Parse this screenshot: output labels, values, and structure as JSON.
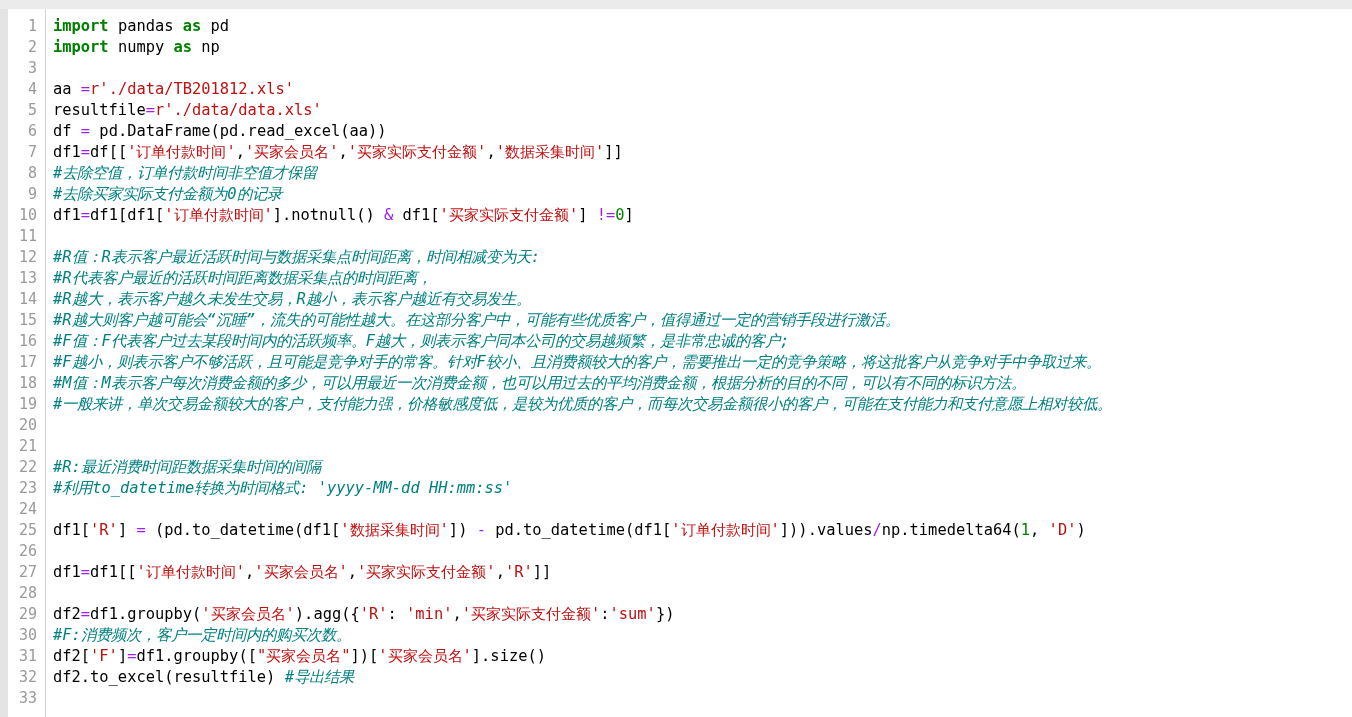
{
  "lines": [
    {
      "number": "1",
      "tokens": [
        {
          "kind": "keyword",
          "text": "import"
        },
        {
          "kind": "plain",
          "text": " pandas "
        },
        {
          "kind": "keyword",
          "text": "as"
        },
        {
          "kind": "plain",
          "text": " pd"
        }
      ]
    },
    {
      "number": "2",
      "tokens": [
        {
          "kind": "keyword",
          "text": "import"
        },
        {
          "kind": "plain",
          "text": " numpy "
        },
        {
          "kind": "keyword",
          "text": "as"
        },
        {
          "kind": "plain",
          "text": " np"
        }
      ]
    },
    {
      "number": "3"
    },
    {
      "number": "4",
      "tokens": [
        {
          "kind": "plain",
          "text": "aa "
        },
        {
          "kind": "operator",
          "text": "="
        },
        {
          "kind": "string",
          "text": "r'./data/TB201812.xls'"
        }
      ]
    },
    {
      "number": "5",
      "tokens": [
        {
          "kind": "plain",
          "text": "resultfile"
        },
        {
          "kind": "operator",
          "text": "="
        },
        {
          "kind": "string",
          "text": "r'./data/data.xls'"
        }
      ]
    },
    {
      "number": "6",
      "tokens": [
        {
          "kind": "plain",
          "text": "df "
        },
        {
          "kind": "operator",
          "text": "="
        },
        {
          "kind": "plain",
          "text": " pd.DataFrame(pd.read_excel(aa))"
        }
      ]
    },
    {
      "number": "7",
      "tokens": [
        {
          "kind": "plain",
          "text": "df1"
        },
        {
          "kind": "operator",
          "text": "="
        },
        {
          "kind": "plain",
          "text": "df[["
        },
        {
          "kind": "string",
          "text": "'订单付款时间'"
        },
        {
          "kind": "plain",
          "text": ","
        },
        {
          "kind": "string",
          "text": "'买家会员名'"
        },
        {
          "kind": "plain",
          "text": ","
        },
        {
          "kind": "string",
          "text": "'买家实际支付金额'"
        },
        {
          "kind": "plain",
          "text": ","
        },
        {
          "kind": "string",
          "text": "'数据采集时间'"
        },
        {
          "kind": "plain",
          "text": "]]"
        }
      ]
    },
    {
      "number": "8",
      "tokens": [
        {
          "kind": "comment",
          "text": "#去除空值，订单付款时间非空值才保留"
        }
      ]
    },
    {
      "number": "9",
      "tokens": [
        {
          "kind": "comment",
          "text": "#去除买家实际支付金额为0的记录"
        }
      ]
    },
    {
      "number": "10",
      "tokens": [
        {
          "kind": "plain",
          "text": "df1"
        },
        {
          "kind": "operator",
          "text": "="
        },
        {
          "kind": "plain",
          "text": "df1[df1["
        },
        {
          "kind": "string",
          "text": "'订单付款时间'"
        },
        {
          "kind": "plain",
          "text": "].notnull() "
        },
        {
          "kind": "operator",
          "text": "&"
        },
        {
          "kind": "plain",
          "text": " df1["
        },
        {
          "kind": "string",
          "text": "'买家实际支付金额'"
        },
        {
          "kind": "plain",
          "text": "] "
        },
        {
          "kind": "operator",
          "text": "!="
        },
        {
          "kind": "number",
          "text": "0"
        },
        {
          "kind": "plain",
          "text": "]"
        }
      ]
    },
    {
      "number": "11"
    },
    {
      "number": "12",
      "tokens": [
        {
          "kind": "comment",
          "text": "#R值：R表示客户最近活跃时间与数据采集点时间距离，时间相减变为天:"
        }
      ]
    },
    {
      "number": "13",
      "tokens": [
        {
          "kind": "comment",
          "text": "#R代表客户最近的活跃时间距离数据采集点的时间距离，"
        }
      ]
    },
    {
      "number": "14",
      "tokens": [
        {
          "kind": "comment",
          "text": "#R越大，表示客户越久未发生交易，R越小，表示客户越近有交易发生。"
        }
      ]
    },
    {
      "number": "15",
      "tokens": [
        {
          "kind": "comment",
          "text": "#R越大则客户越可能会“沉睡”，流失的可能性越大。在这部分客户中，可能有些优质客户，值得通过一定的营销手段进行激活。"
        }
      ]
    },
    {
      "number": "16",
      "tokens": [
        {
          "kind": "comment",
          "text": "#F值：F代表客户过去某段时间内的活跃频率。F越大，则表示客户同本公司的交易越频繁，是非常忠诚的客户;"
        }
      ]
    },
    {
      "number": "17",
      "tokens": [
        {
          "kind": "comment",
          "text": "#F越小，则表示客户不够活跃，且可能是竞争对手的常客。针对F较小、且消费额较大的客户，需要推出一定的竞争策略，将这批客户从竞争对手中争取过来。"
        }
      ]
    },
    {
      "number": "18",
      "tokens": [
        {
          "kind": "comment",
          "text": "#M值：M表示客户每次消费金额的多少，可以用最近一次消费金额，也可以用过去的平均消费金额，根据分析的目的不同，可以有不同的标识方法。"
        }
      ]
    },
    {
      "number": "19",
      "tokens": [
        {
          "kind": "comment",
          "text": "#一般来讲，单次交易金额较大的客户，支付能力强，价格敏感度低，是较为优质的客户，而每次交易金额很小的客户，可能在支付能力和支付意愿上相对较低。"
        }
      ]
    },
    {
      "number": "20"
    },
    {
      "number": "21"
    },
    {
      "number": "22",
      "tokens": [
        {
          "kind": "comment",
          "text": "#R:最近消费时间距数据采集时间的间隔"
        }
      ]
    },
    {
      "number": "23",
      "tokens": [
        {
          "kind": "comment",
          "text": "#利用to_datetime转换为时间格式: 'yyyy-MM-dd HH:mm:ss'"
        }
      ]
    },
    {
      "number": "24"
    },
    {
      "number": "25",
      "tokens": [
        {
          "kind": "plain",
          "text": "df1["
        },
        {
          "kind": "string",
          "text": "'R'"
        },
        {
          "kind": "plain",
          "text": "] "
        },
        {
          "kind": "operator",
          "text": "="
        },
        {
          "kind": "plain",
          "text": " (pd.to_datetime(df1["
        },
        {
          "kind": "string",
          "text": "'数据采集时间'"
        },
        {
          "kind": "plain",
          "text": "]) "
        },
        {
          "kind": "operator",
          "text": "-"
        },
        {
          "kind": "plain",
          "text": " pd.to_datetime(df1["
        },
        {
          "kind": "string",
          "text": "'订单付款时间'"
        },
        {
          "kind": "plain",
          "text": "])).values"
        },
        {
          "kind": "operator",
          "text": "/"
        },
        {
          "kind": "plain",
          "text": "np.timedelta64("
        },
        {
          "kind": "number",
          "text": "1"
        },
        {
          "kind": "plain",
          "text": ", "
        },
        {
          "kind": "string",
          "text": "'D'"
        },
        {
          "kind": "plain",
          "text": ")"
        }
      ]
    },
    {
      "number": "26"
    },
    {
      "number": "27",
      "tokens": [
        {
          "kind": "plain",
          "text": "df1"
        },
        {
          "kind": "operator",
          "text": "="
        },
        {
          "kind": "plain",
          "text": "df1[["
        },
        {
          "kind": "string",
          "text": "'订单付款时间'"
        },
        {
          "kind": "plain",
          "text": ","
        },
        {
          "kind": "string",
          "text": "'买家会员名'"
        },
        {
          "kind": "plain",
          "text": ","
        },
        {
          "kind": "string",
          "text": "'买家实际支付金额'"
        },
        {
          "kind": "plain",
          "text": ","
        },
        {
          "kind": "string",
          "text": "'R'"
        },
        {
          "kind": "plain",
          "text": "]]"
        }
      ]
    },
    {
      "number": "28"
    },
    {
      "number": "29",
      "tokens": [
        {
          "kind": "plain",
          "text": "df2"
        },
        {
          "kind": "operator",
          "text": "="
        },
        {
          "kind": "plain",
          "text": "df1.groupby("
        },
        {
          "kind": "string",
          "text": "'买家会员名'"
        },
        {
          "kind": "plain",
          "text": ").agg({"
        },
        {
          "kind": "string",
          "text": "'R'"
        },
        {
          "kind": "plain",
          "text": ": "
        },
        {
          "kind": "string",
          "text": "'min'"
        },
        {
          "kind": "plain",
          "text": ","
        },
        {
          "kind": "string",
          "text": "'买家实际支付金额'"
        },
        {
          "kind": "plain",
          "text": ":"
        },
        {
          "kind": "string",
          "text": "'sum'"
        },
        {
          "kind": "plain",
          "text": "})"
        }
      ]
    },
    {
      "number": "30",
      "tokens": [
        {
          "kind": "comment",
          "text": "#F:消费频次，客户一定时间内的购买次数。"
        }
      ]
    },
    {
      "number": "31",
      "tokens": [
        {
          "kind": "plain",
          "text": "df2["
        },
        {
          "kind": "string",
          "text": "'F'"
        },
        {
          "kind": "plain",
          "text": "]"
        },
        {
          "kind": "operator",
          "text": "="
        },
        {
          "kind": "plain",
          "text": "df1.groupby(["
        },
        {
          "kind": "string",
          "text": "\"买家会员名\""
        },
        {
          "kind": "plain",
          "text": "])["
        },
        {
          "kind": "string",
          "text": "'买家会员名'"
        },
        {
          "kind": "plain",
          "text": "].size()"
        }
      ]
    },
    {
      "number": "32",
      "tokens": [
        {
          "kind": "plain",
          "text": "df2.to_excel(resultfile) "
        },
        {
          "kind": "comment",
          "text": "#导出结果"
        }
      ]
    },
    {
      "number": "33"
    }
  ]
}
